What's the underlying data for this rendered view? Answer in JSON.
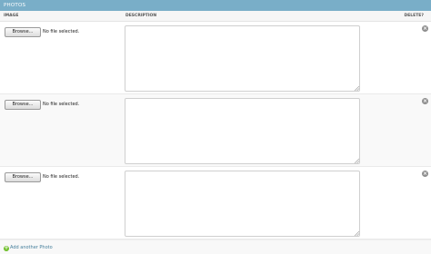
{
  "section": {
    "title": "PHOTOS"
  },
  "columns": {
    "image": "IMAGE",
    "description": "DESCRIPTION",
    "delete": "DELETE?"
  },
  "rows": [
    {
      "browse_label": "Browse...",
      "file_status": "No file selected.",
      "description": ""
    },
    {
      "browse_label": "Browse...",
      "file_status": "No file selected.",
      "description": ""
    },
    {
      "browse_label": "Browse...",
      "file_status": "No file selected.",
      "description": ""
    }
  ],
  "add_another": {
    "label": "Add another Photo"
  },
  "icons": {
    "delete": "delete-icon",
    "add": "add-icon",
    "resize": "resize-grip-icon"
  },
  "colors": {
    "caption_bg": "#79aec8",
    "link": "#447e9b",
    "add_icon": "#70bf2b"
  }
}
